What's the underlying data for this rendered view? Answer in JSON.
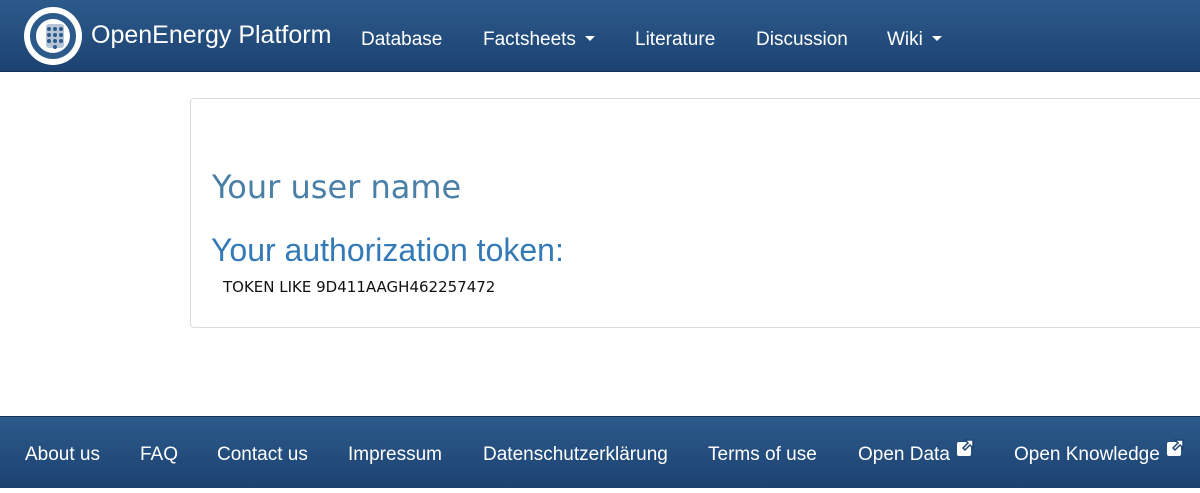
{
  "navbar": {
    "brand": "OpenEnergy Platform",
    "logo_icon": "openenergy-logo-icon",
    "items": [
      {
        "label": "Database",
        "dropdown": false
      },
      {
        "label": "Factsheets",
        "dropdown": true
      },
      {
        "label": "Literature",
        "dropdown": false
      },
      {
        "label": "Discussion",
        "dropdown": false
      },
      {
        "label": "Wiki",
        "dropdown": true
      }
    ]
  },
  "content": {
    "user_name_heading": "Your user name",
    "token_heading": "Your authorization token:",
    "token_value": "TOKEN LIKE 9D411AAGH462257472"
  },
  "footer": {
    "items": [
      {
        "label": "About us",
        "external": false
      },
      {
        "label": "FAQ",
        "external": false
      },
      {
        "label": "Contact us",
        "external": false
      },
      {
        "label": "Impressum",
        "external": false
      },
      {
        "label": "Datenschutzerklärung",
        "external": false
      },
      {
        "label": "Terms of use",
        "external": false
      },
      {
        "label": "Open Data",
        "external": true
      },
      {
        "label": "Open Knowledge",
        "external": true
      }
    ]
  },
  "colors": {
    "navbar_top": "#2c5a8b",
    "navbar_bottom": "#1c4271",
    "heading_blue": "#337ab7",
    "username_blue": "#4a7fa8"
  }
}
